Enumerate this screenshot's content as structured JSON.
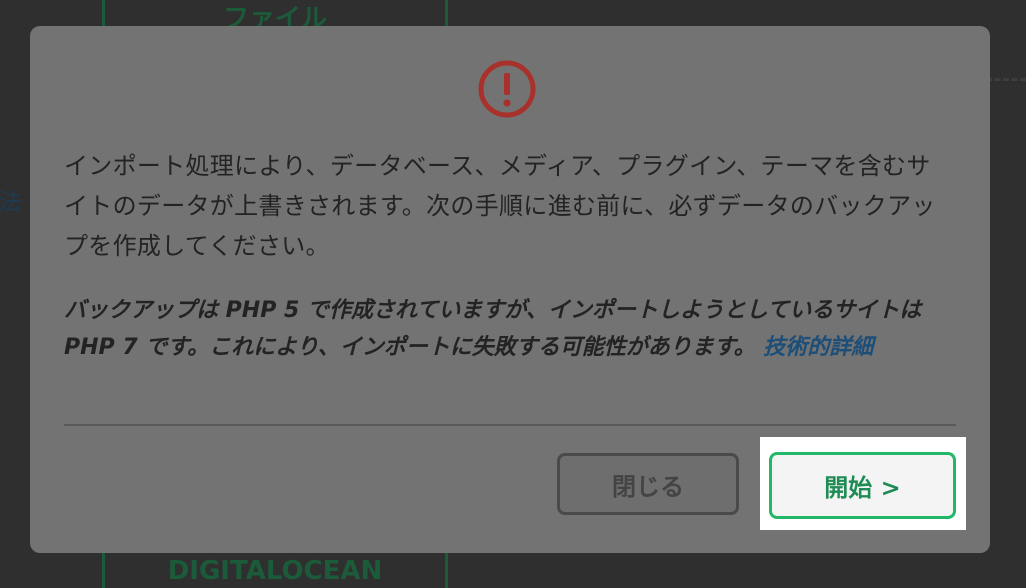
{
  "background": {
    "top_card_label": "ファイル",
    "bottom_card_label": "DIGITALOCEAN",
    "side_fragment": "法"
  },
  "modal": {
    "icon": "exclamation-circle-icon",
    "icon_color": "#a8312b",
    "message": "インポート処理により、データベース、メディア、プラグイン、テーマを含むサイトのデータが上書きされます。次の手順に進む前に、必ずデータのバックアップを作成してください。",
    "php_warning": "バックアップは PHP 5 で作成されていますが、インポートしようとしているサイトは PHP 7 です。これにより、インポートに失敗する可能性があります。",
    "details_link": "技術的詳細",
    "close_label": "閉じる",
    "start_label": "開始 >",
    "accent_color": "#22b868",
    "link_color": "#1c4e78"
  }
}
